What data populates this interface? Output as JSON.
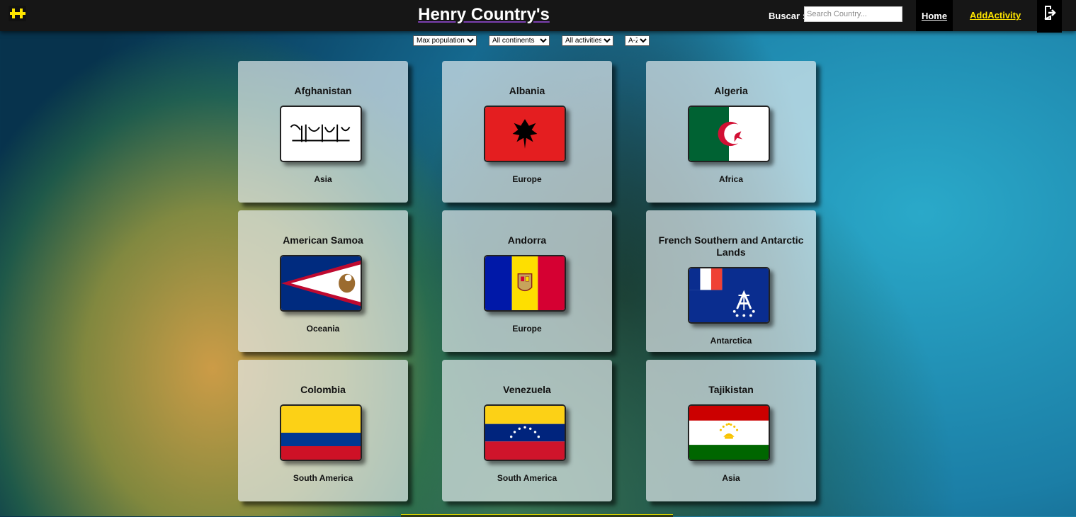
{
  "header": {
    "title": "Henry Country's",
    "search_label": "Buscar :",
    "search_placeholder": "Search Country...",
    "home_label": "Home",
    "add_activity_label": "AddActivity",
    "logo_icon": "henry-logo-icon",
    "logout_icon": "logout-icon"
  },
  "filters": {
    "sort_population": "Max population",
    "continents": "All continents",
    "activities": "All activities",
    "sort_alpha": "A-Z"
  },
  "countries": [
    {
      "name": "Afghanistan",
      "continent": "Asia",
      "flag": "afghanistan-flag"
    },
    {
      "name": "Albania",
      "continent": "Europe",
      "flag": "albania-flag"
    },
    {
      "name": "Algeria",
      "continent": "Africa",
      "flag": "algeria-flag"
    },
    {
      "name": "American Samoa",
      "continent": "Oceania",
      "flag": "american-samoa-flag"
    },
    {
      "name": "Andorra",
      "continent": "Europe",
      "flag": "andorra-flag"
    },
    {
      "name": "French Southern and Antarctic Lands",
      "continent": "Antarctica",
      "flag": "french-southern-lands-flag"
    },
    {
      "name": "Colombia",
      "continent": "South America",
      "flag": "colombia-flag"
    },
    {
      "name": "Venezuela",
      "continent": "South America",
      "flag": "venezuela-flag"
    },
    {
      "name": "Tajikistan",
      "continent": "Asia",
      "flag": "tajikistan-flag"
    }
  ],
  "colors": {
    "navbar": "#161616",
    "accent_yellow": "#ffe600",
    "title_underline": "#7b3fb0"
  }
}
